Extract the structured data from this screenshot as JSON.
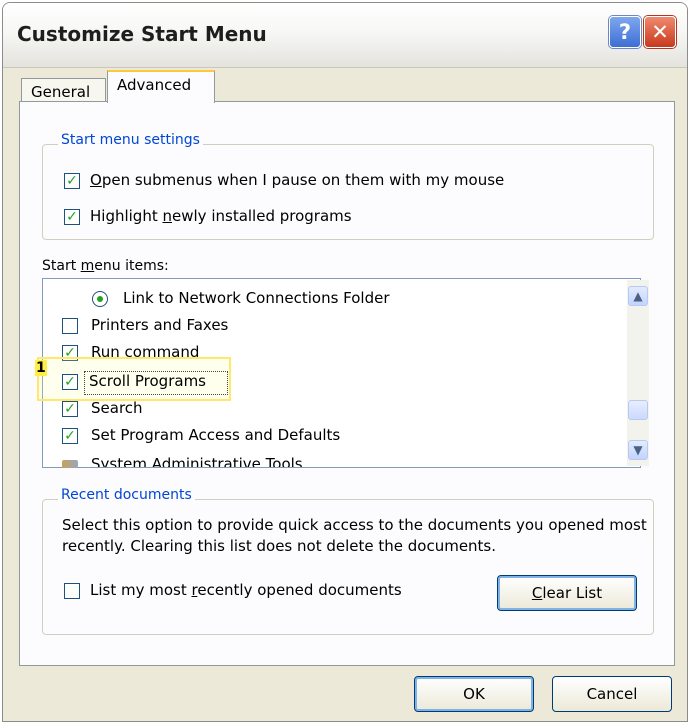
{
  "window": {
    "title": "Customize Start Menu",
    "help_glyph": "?",
    "close_glyph": "✕"
  },
  "tabs": [
    {
      "label": "General"
    },
    {
      "label": "Advanced"
    }
  ],
  "start_menu_settings": {
    "title": "Start menu settings",
    "open_submenus": {
      "label_key": "O",
      "label_rest": "pen submenus when I pause on them with my mouse",
      "checked": true
    },
    "highlight_new": {
      "label_before": "Highlight ",
      "label_key": "n",
      "label_rest": "ewly installed programs",
      "checked": true
    }
  },
  "start_menu_items": {
    "label_before": "Start ",
    "label_key": "m",
    "label_rest": "enu items:",
    "items": [
      {
        "label": "Link to Network Connections Folder",
        "type": "radio",
        "checked": true
      },
      {
        "label": "Printers and Faxes",
        "type": "checkbox",
        "checked": false
      },
      {
        "label": "Run command",
        "type": "checkbox",
        "checked": true
      },
      {
        "label": "Scroll Programs",
        "type": "checkbox",
        "checked": true,
        "selected": true
      },
      {
        "label": "Search",
        "type": "checkbox",
        "checked": true
      },
      {
        "label": "Set Program Access and Defaults",
        "type": "checkbox",
        "checked": true
      },
      {
        "label": "System Administrative Tools",
        "type": "folder",
        "checked": false
      }
    ]
  },
  "annotation": {
    "number": "1"
  },
  "recent_documents": {
    "title": "Recent documents",
    "description": "Select this option to provide quick access to the documents you opened most recently.  Clearing this list does not delete the documents.",
    "list_recent": {
      "label_before": "List my most ",
      "label_key": "r",
      "label_rest": "ecently opened documents",
      "checked": false
    },
    "clear_button": {
      "label_key": "C",
      "label_rest": "lear List"
    }
  },
  "buttons": {
    "ok": "OK",
    "cancel": "Cancel"
  },
  "colors": {
    "group_title": "#0046d5",
    "check": "#21a121",
    "highlight": "#ffe86a"
  }
}
